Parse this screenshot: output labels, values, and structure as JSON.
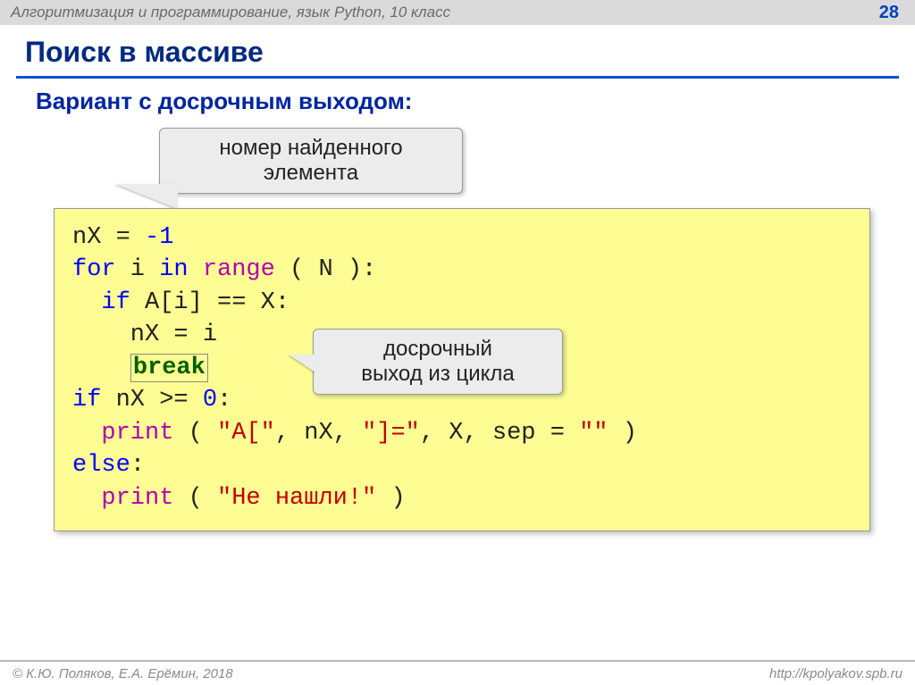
{
  "header": {
    "course": "Алгоритмизация и программирование, язык Python, 10 класс",
    "page": "28"
  },
  "title": "Поиск в массиве",
  "subtitle": "Вариант с досрочным выходом:",
  "callouts": {
    "top_line1": "номер найденного",
    "top_line2": "элемента",
    "right_line1": "досрочный",
    "right_line2": "выход из цикла"
  },
  "code": {
    "l1_a": "nX",
    "l1_eq": " = ",
    "l1_b": "-1",
    "l2_for": "for",
    "l2_i": " i ",
    "l2_in": "in",
    "l2_sp": " ",
    "l2_range": "range",
    "l2_par": " ( N ):",
    "l3_if": "  if",
    "l3_cond": " A[i] == X:",
    "l4": "    nX = i",
    "l5_pad": "    ",
    "l5_break": "break",
    "l6_if": "if",
    "l6_cond": " nX >= ",
    "l6_zero": "0",
    "l6_colon": ":",
    "l7_pad": "  ",
    "l7_print": "print",
    "l7_open": " ( ",
    "l7_s1": "\"A[\"",
    "l7_c1": ", nX, ",
    "l7_s2": "\"]=\"",
    "l7_c2": ", X, sep = ",
    "l7_s3": "\"\"",
    "l7_close": " )",
    "l8_else": "else",
    "l8_colon": ":",
    "l9_pad": "  ",
    "l9_print": "print",
    "l9_open": " ( ",
    "l9_s": "\"Не нашли!\"",
    "l9_close": " )"
  },
  "footer": {
    "left": "© К.Ю. Поляков, Е.А. Ерёмин, 2018",
    "right": "http://kpolyakov.spb.ru"
  }
}
